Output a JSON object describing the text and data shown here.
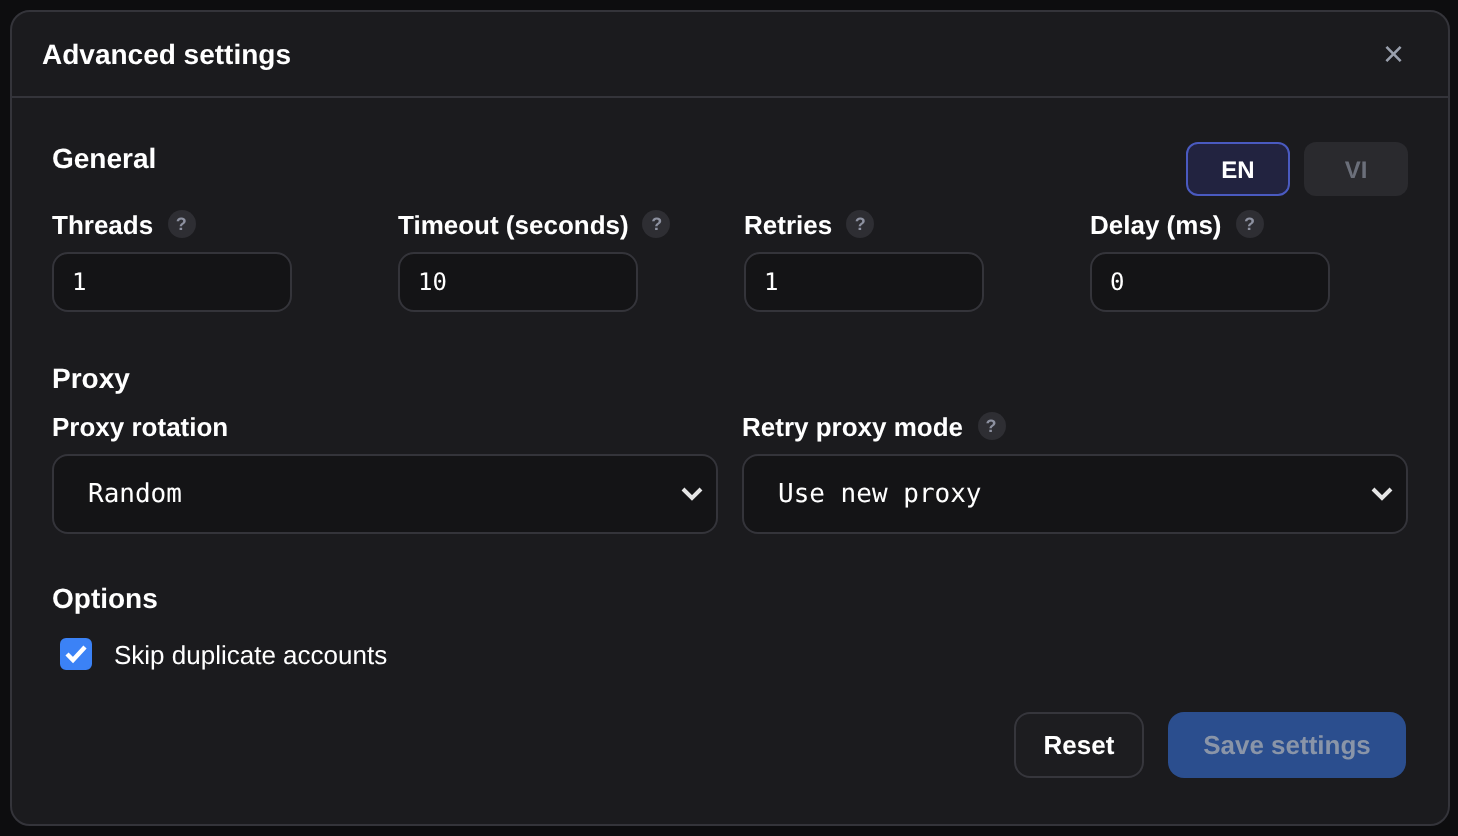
{
  "dialog": {
    "title": "Advanced settings",
    "close": "×"
  },
  "general": {
    "heading": "General",
    "languages": [
      {
        "label": "EN",
        "selected": true
      },
      {
        "label": "VI",
        "selected": false
      }
    ],
    "fields": [
      {
        "label": "Threads",
        "help": "?",
        "value": "1"
      },
      {
        "label": "Timeout (seconds)",
        "help": "?",
        "value": "10"
      },
      {
        "label": "Retries",
        "help": "?",
        "value": "1"
      },
      {
        "label": "Delay (ms)",
        "help": "?",
        "value": "0"
      }
    ]
  },
  "proxy": {
    "heading": "Proxy",
    "selects": [
      {
        "label": "Proxy rotation",
        "value": "Random"
      },
      {
        "label": "Retry proxy mode",
        "help": "?",
        "value": "Use new proxy"
      }
    ]
  },
  "options": {
    "heading": "Options",
    "checkboxes": [
      {
        "label": "Skip duplicate accounts",
        "checked": true
      }
    ]
  },
  "buttons": [
    {
      "label": "Reset",
      "kind": "secondary",
      "disabled": false
    },
    {
      "label": "Save settings",
      "kind": "primary",
      "disabled": true
    }
  ]
}
